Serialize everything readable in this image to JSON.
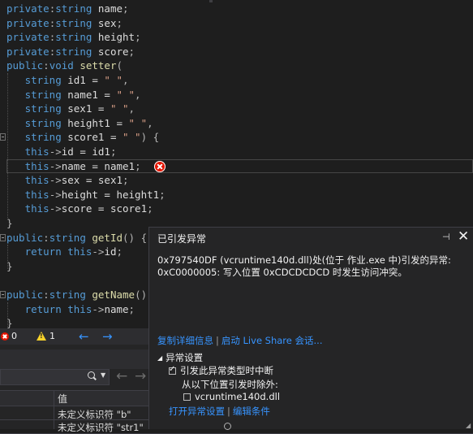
{
  "editor": {
    "lines": [
      [
        [
          "kw",
          "private"
        ],
        [
          "op",
          ":"
        ],
        [
          "kw",
          "string"
        ],
        [
          "",
          "  name"
        ],
        [
          "op",
          ";"
        ]
      ],
      [
        [
          "kw",
          "private"
        ],
        [
          "op",
          ":"
        ],
        [
          "kw",
          "string"
        ],
        [
          "",
          "  sex"
        ],
        [
          "op",
          ";"
        ]
      ],
      [
        [
          "kw",
          "private"
        ],
        [
          "op",
          ":"
        ],
        [
          "kw",
          "string"
        ],
        [
          "",
          "  height"
        ],
        [
          "op",
          ";"
        ]
      ],
      [
        [
          "kw",
          "private"
        ],
        [
          "op",
          ":"
        ],
        [
          "kw",
          "string"
        ],
        [
          "",
          "  score"
        ],
        [
          "op",
          ";"
        ]
      ],
      [
        [
          "kw",
          "public"
        ],
        [
          "op",
          ":"
        ],
        [
          "kw",
          "void"
        ],
        [
          "fn",
          " setter"
        ],
        [
          "op",
          "("
        ]
      ],
      [
        [
          "",
          "    "
        ],
        [
          "kw",
          "string"
        ],
        [
          "",
          "",
          " id1 = "
        ],
        [
          "str",
          "\" \""
        ],
        [
          "op",
          ","
        ]
      ],
      [
        [
          "",
          "    "
        ],
        [
          "kw",
          "string"
        ],
        [
          "",
          "",
          " name1 = "
        ],
        [
          "str",
          "\" \""
        ],
        [
          "op",
          ","
        ]
      ],
      [
        [
          "",
          "    "
        ],
        [
          "kw",
          "string"
        ],
        [
          "",
          "",
          " sex1 = "
        ],
        [
          "str",
          "\" \""
        ],
        [
          "op",
          ","
        ]
      ],
      [
        [
          "",
          "    "
        ],
        [
          "kw",
          "string"
        ],
        [
          "",
          "",
          " height1 = "
        ],
        [
          "str",
          "\" \""
        ],
        [
          "op",
          ","
        ]
      ],
      [
        [
          "",
          "    "
        ],
        [
          "kw",
          "string"
        ],
        [
          "",
          "",
          " score1 = "
        ],
        [
          "str",
          "\" \""
        ],
        [
          "op",
          ") {"
        ]
      ],
      [
        [
          "",
          "    "
        ],
        [
          "kw",
          "this"
        ],
        [
          "op",
          "->"
        ],
        [
          "",
          "id = id1"
        ],
        [
          "op",
          ";"
        ]
      ],
      [
        [
          "",
          "    "
        ],
        [
          "kw",
          "this"
        ],
        [
          "op",
          "->"
        ],
        [
          "",
          "name = name1"
        ],
        [
          "op",
          ";"
        ]
      ],
      [
        [
          "",
          "    "
        ],
        [
          "kw",
          "this"
        ],
        [
          "op",
          "->"
        ],
        [
          "",
          "sex = sex1"
        ],
        [
          "op",
          ";"
        ]
      ],
      [
        [
          "",
          "    "
        ],
        [
          "kw",
          "this"
        ],
        [
          "op",
          "->"
        ],
        [
          "",
          "height = height1"
        ],
        [
          "op",
          ";"
        ]
      ],
      [
        [
          "",
          "    "
        ],
        [
          "kw",
          "this"
        ],
        [
          "op",
          "->"
        ],
        [
          "",
          "score = score1"
        ],
        [
          "op",
          ";"
        ]
      ],
      [
        [
          "op",
          "}"
        ]
      ],
      [
        [
          "kw",
          "public"
        ],
        [
          "op",
          ":"
        ],
        [
          "kw",
          "string"
        ],
        [
          "fn",
          " getId"
        ],
        [
          "op",
          "() {"
        ]
      ],
      [
        [
          "",
          "    "
        ],
        [
          "kw",
          "return"
        ],
        [
          "kw",
          " this"
        ],
        [
          "op",
          "->"
        ],
        [
          "",
          "id"
        ],
        [
          "op",
          ";"
        ]
      ],
      [
        [
          "op",
          "}"
        ]
      ],
      [
        [
          "",
          ""
        ]
      ],
      [
        [
          "kw",
          "public"
        ],
        [
          "op",
          ":"
        ],
        [
          "kw",
          "string"
        ],
        [
          "fn",
          " getName"
        ],
        [
          "op",
          "()"
        ]
      ],
      [
        [
          "",
          "    "
        ],
        [
          "kw",
          "return"
        ],
        [
          "kw",
          " this"
        ],
        [
          "op",
          "->"
        ],
        [
          "",
          "name"
        ],
        [
          "op",
          ";"
        ]
      ],
      [
        [
          "op",
          "}"
        ]
      ]
    ]
  },
  "status": {
    "errors": "0",
    "warnings": "1"
  },
  "lower_panel": {
    "column_header": "值",
    "rows": [
      "未定义标识符 \"b\"",
      "未定义标识符 \"str1\""
    ]
  },
  "popup": {
    "title": "已引发异常",
    "pin_glyph": "⊣",
    "close_glyph": "✕",
    "message_line1": "0x797540DF (vcruntime140d.dll)处(位于 作业.exe 中)引发的异常:",
    "message_line2": "0xC0000005: 写入位置 0xCDCDCDCD 时发生访问冲突。",
    "copy_details": "复制详细信息",
    "live_share": "启动 Live Share 会话...",
    "section_title": "异常设置",
    "break_when": "引发此异常类型时中断",
    "except_from": "从以下位置引发时除外:",
    "module": "vcruntime140d.dll",
    "open_settings": "打开异常设置",
    "edit_conditions": "编辑条件"
  },
  "colors": {
    "editor_bg": "#1e1e1e",
    "keyword": "#569cd6",
    "function": "#dcdcaa",
    "string": "#d69d85",
    "link": "#3794ff",
    "error": "#e51400",
    "warning": "#f8d22a"
  }
}
